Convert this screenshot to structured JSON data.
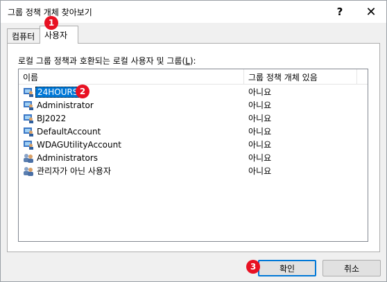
{
  "window": {
    "title": "그룹 정책 개체 찾아보기",
    "help_glyph": "?",
    "close_glyph": "✕"
  },
  "tabs": [
    {
      "label": "컴퓨터"
    },
    {
      "label": "사용자"
    }
  ],
  "panel": {
    "label_prefix": "로컬 그룹 정책과 호환되는 로컬 사용자 및 그룹(",
    "label_accel": "L",
    "label_suffix": "):"
  },
  "list": {
    "columns": [
      "이름",
      "그룹 정책 개체 있음"
    ],
    "rows": [
      {
        "name": "24HOURS",
        "status": "아니요",
        "icon": "user-icon",
        "selected": true
      },
      {
        "name": "Administrator",
        "status": "아니요",
        "icon": "user-icon"
      },
      {
        "name": "BJ2022",
        "status": "아니요",
        "icon": "user-icon"
      },
      {
        "name": "DefaultAccount",
        "status": "아니요",
        "icon": "user-icon"
      },
      {
        "name": "WDAGUtilityAccount",
        "status": "아니요",
        "icon": "user-icon"
      },
      {
        "name": "Administrators",
        "status": "아니요",
        "icon": "group-icon"
      },
      {
        "name": "관리자가 아닌 사용자",
        "status": "아니요",
        "icon": "group-icon"
      }
    ]
  },
  "buttons": {
    "ok": "확인",
    "cancel": "취소"
  },
  "badges": [
    "1",
    "2",
    "3"
  ],
  "colors": {
    "badge": "#e81123",
    "selection": "#0078d7"
  }
}
